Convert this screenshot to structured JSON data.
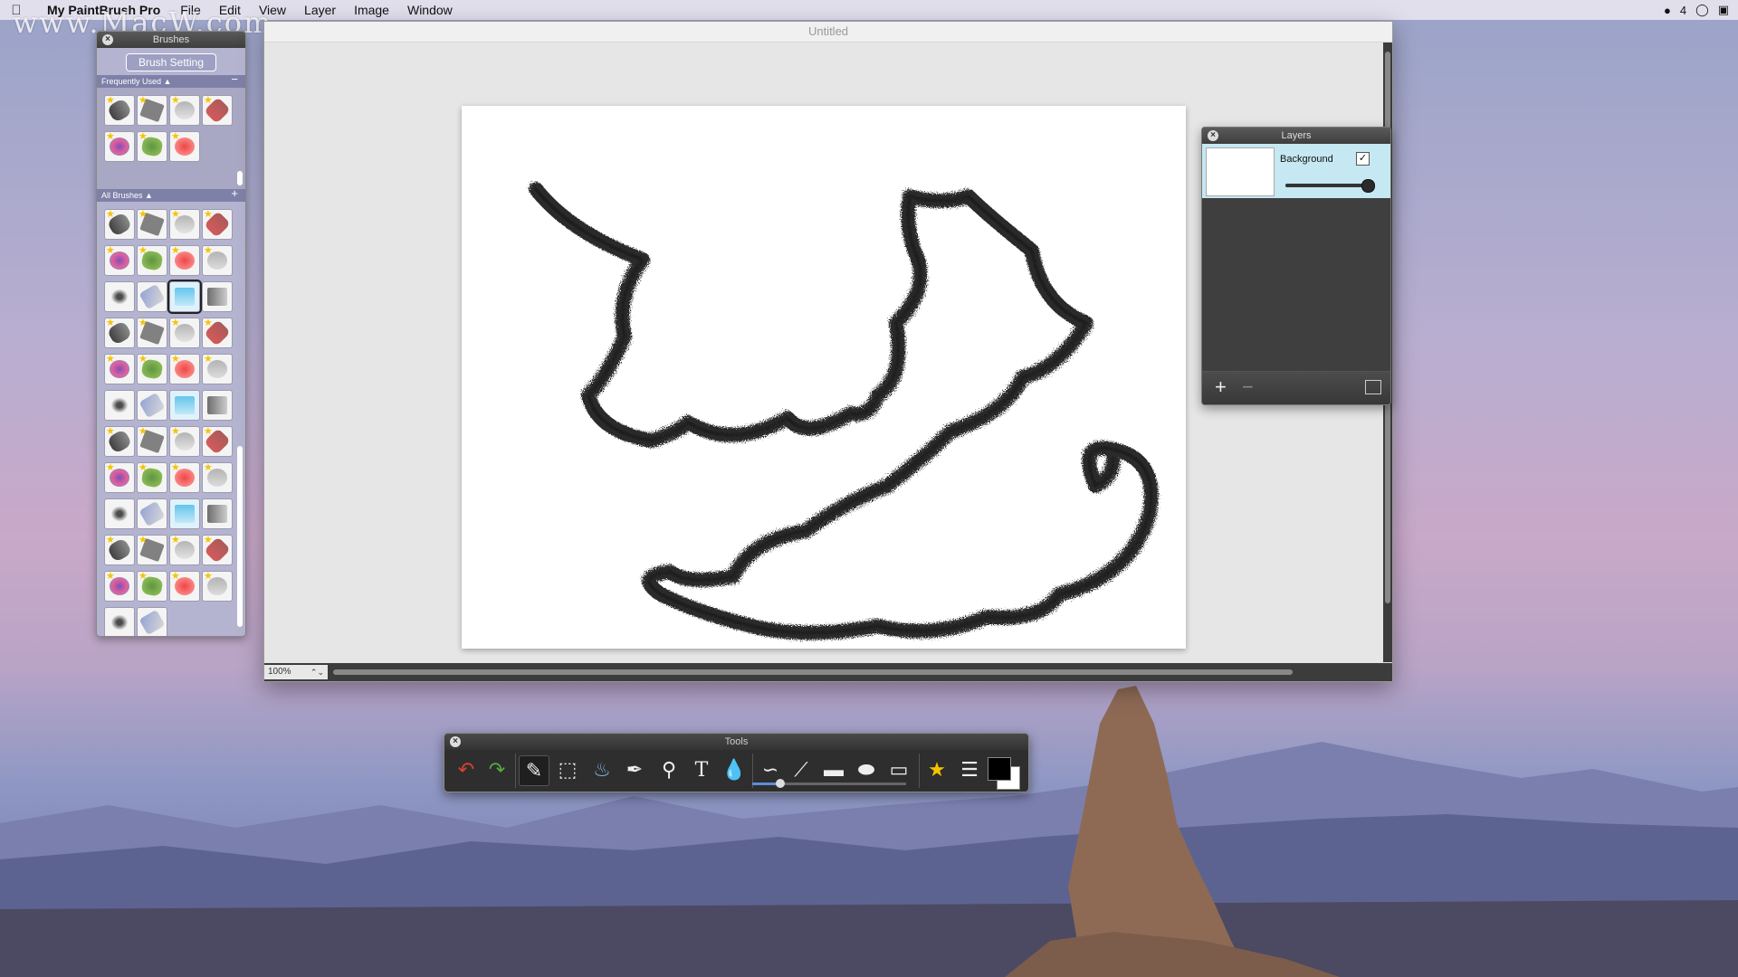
{
  "menubar": {
    "app_name": "My PaintBrush Pro",
    "items": [
      "File",
      "Edit",
      "View",
      "Layer",
      "Image",
      "Window"
    ],
    "notification_count": "4"
  },
  "watermark": "www.MacW.com",
  "brushes_panel": {
    "title": "Brushes",
    "brush_setting_label": "Brush Setting",
    "frequently_used_label": "Frequently Used",
    "all_brushes_label": "All Brushes"
  },
  "document": {
    "title": "Untitled",
    "zoom": "100%"
  },
  "layers_panel": {
    "title": "Layers",
    "layers": [
      {
        "name": "Background",
        "visible": true,
        "opacity": 0.95
      }
    ]
  },
  "tools_panel": {
    "title": "Tools",
    "tools": [
      "undo-icon",
      "redo-icon",
      "brush-icon",
      "selection-icon",
      "fill-icon",
      "eyedropper-icon",
      "zoom-icon",
      "text-icon",
      "drop-icon",
      "curve-icon",
      "line-icon",
      "rectangle-icon",
      "ellipse-icon",
      "rounded-rect-icon",
      "effects-icon",
      "layers-icon",
      "color-swap-icon"
    ],
    "stroke_size": 0.18,
    "foreground_color": "#000000",
    "background_color": "#ffffff"
  },
  "colors": {
    "accent": "#5b8ed6",
    "panel_dark": "#2e2e2e",
    "layer_selected": "#c5e8f2",
    "brush_panel": "#b4b4d0"
  }
}
